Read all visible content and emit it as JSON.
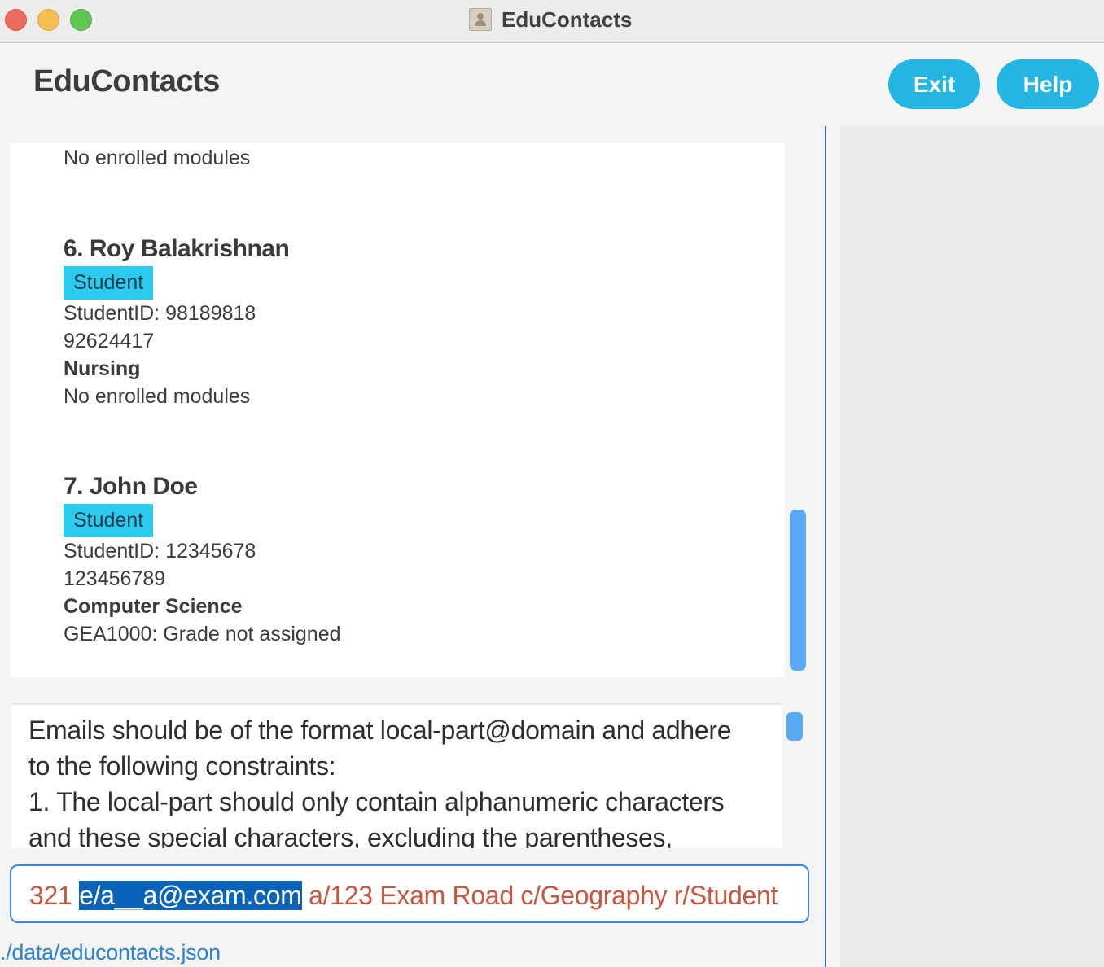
{
  "window": {
    "title": "EduContacts"
  },
  "header": {
    "app_name": "EduContacts",
    "exit_label": "Exit",
    "help_label": "Help"
  },
  "contacts": [
    {
      "partial_line": "No enrolled modules"
    },
    {
      "name": "6. Roy Balakrishnan",
      "role": "Student",
      "student_id": "StudentID: 98189818",
      "phone": "92624417",
      "course": "Nursing",
      "modules": "No enrolled modules"
    },
    {
      "name": "7. John Doe",
      "role": "Student",
      "student_id": "StudentID: 12345678",
      "phone": "123456789",
      "course": "Computer Science",
      "modules": "GEA1000: Grade not assigned"
    }
  ],
  "result_display": {
    "text": "Emails should be of the format local-part@domain and adhere\nto the following constraints:\n1. The local-part should only contain alphanumeric characters\nand these special characters, excluding the parentheses,"
  },
  "command_box": {
    "before_selection": "321 ",
    "selection": "e/a__a@exam.com",
    "after_selection": " a/123 Exam Road c/Geography r/Student"
  },
  "status_bar": {
    "file_path": "./data/educontacts.json"
  },
  "colors": {
    "accent": "#23b6e3",
    "tag": "#2bcbef",
    "error_text": "#c8553d",
    "divider": "#2f6fd6"
  }
}
